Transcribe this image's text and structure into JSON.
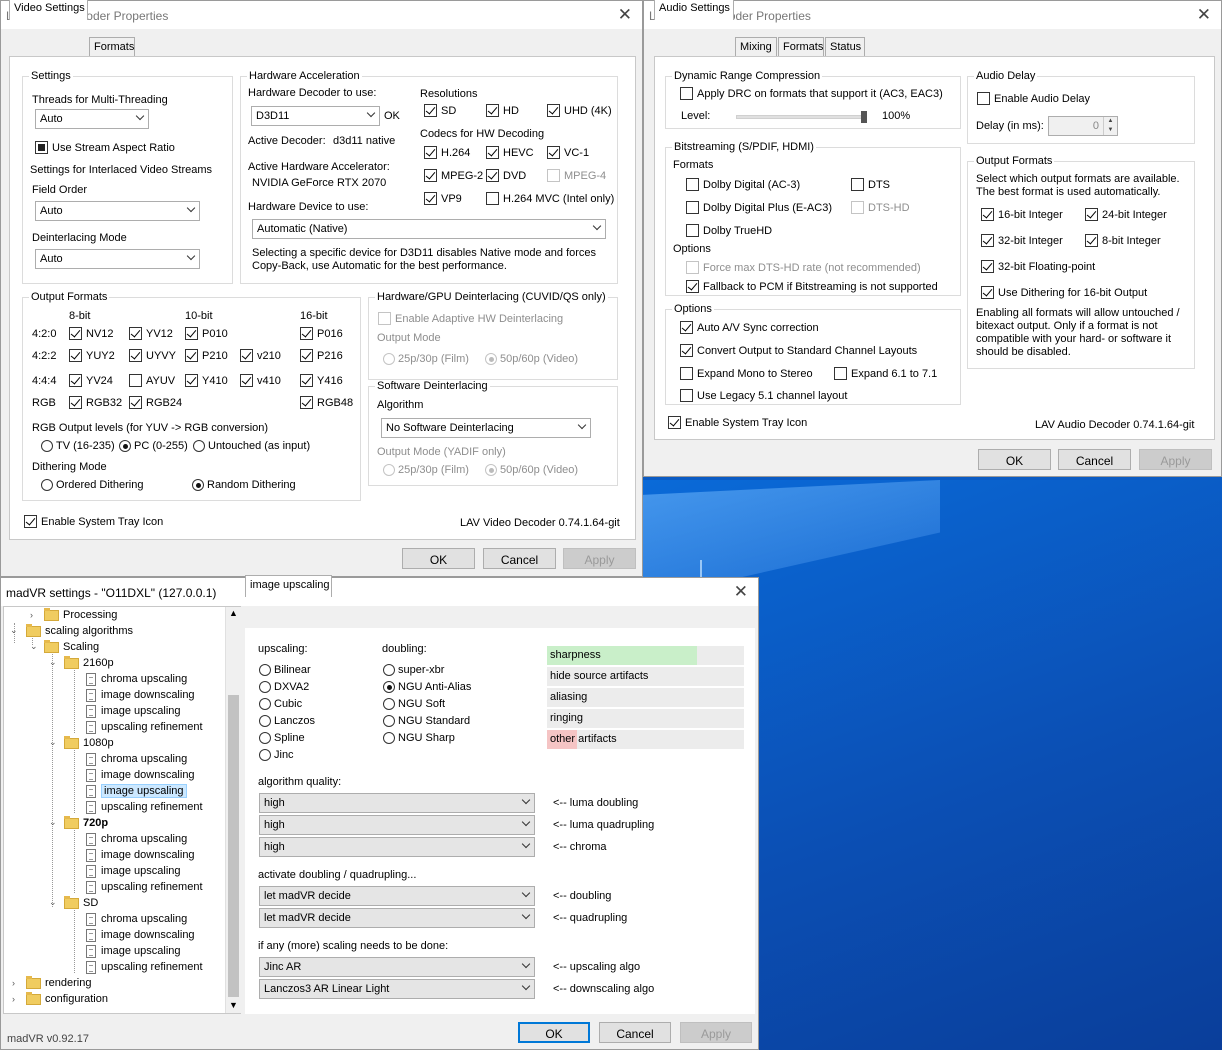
{
  "video": {
    "title": "LAV Video Decoder Properties",
    "tabs": [
      "Video Settings",
      "Formats"
    ],
    "settings": {
      "label": "Settings",
      "threads_label": "Threads for Multi-Threading",
      "threads_value": "Auto",
      "aspect_label": "Use Stream Aspect Ratio",
      "interlaced_label": "Settings for Interlaced Video Streams",
      "field_order_label": "Field Order",
      "field_order_value": "Auto",
      "deint_mode_label": "Deinterlacing Mode",
      "deint_mode_value": "Auto"
    },
    "hwaccel": {
      "label": "Hardware Acceleration",
      "decoder_label": "Hardware Decoder to use:",
      "decoder_value": "D3D11",
      "ok": "OK",
      "active_decoder_label": "Active Decoder:",
      "active_decoder_value": "d3d11 native",
      "accelerator_label": "Active Hardware Accelerator:",
      "accelerator_value": "NVIDIA GeForce RTX 2070",
      "device_label": "Hardware Device to use:",
      "device_value": "Automatic (Native)",
      "note": "Selecting a specific device for D3D11 disables Native mode and forces Copy-Back, use Automatic for the best performance.",
      "resolutions_label": "Resolutions",
      "res": [
        "SD",
        "HD",
        "UHD (4K)"
      ],
      "codecs_label": "Codecs for HW Decoding",
      "codecs": [
        "H.264",
        "HEVC",
        "VC-1",
        "MPEG-2",
        "DVD",
        "MPEG-4",
        "VP9",
        "H.264 MVC (Intel only)"
      ]
    },
    "output": {
      "label": "Output Formats",
      "cols": [
        "8-bit",
        "10-bit",
        "16-bit"
      ],
      "rows": [
        "4:2:0",
        "4:2:2",
        "4:4:4",
        "RGB"
      ],
      "fmts": [
        "NV12",
        "YV12",
        "P010",
        "P016",
        "YUY2",
        "UYVY",
        "P210",
        "v210",
        "P216",
        "YV24",
        "AYUV",
        "Y410",
        "v410",
        "Y416",
        "RGB32",
        "RGB24",
        "RGB48"
      ],
      "rgb_levels_label": "RGB Output levels (for YUV -> RGB conversion)",
      "levels": [
        "TV (16-235)",
        "PC (0-255)",
        "Untouched (as input)"
      ],
      "dither_label": "Dithering Mode",
      "dither": [
        "Ordered Dithering",
        "Random Dithering"
      ]
    },
    "hwdeint": {
      "label": "Hardware/GPU Deinterlacing (CUVID/QS only)",
      "adaptive": "Enable Adaptive HW Deinterlacing",
      "output_mode": "Output Mode",
      "film": "25p/30p (Film)",
      "video": "50p/60p (Video)"
    },
    "swdeint": {
      "label": "Software Deinterlacing",
      "algorithm_label": "Algorithm",
      "algorithm_value": "No Software Deinterlacing",
      "output_mode": "Output Mode (YADIF only)",
      "film": "25p/30p (Film)",
      "video": "50p/60p (Video)"
    },
    "tray": "Enable System Tray Icon",
    "version": "LAV Video Decoder 0.74.1.64-git",
    "buttons": [
      "OK",
      "Cancel",
      "Apply"
    ]
  },
  "audio": {
    "title": "LAV Audio Decoder Properties",
    "tabs": [
      "Audio Settings",
      "Mixing",
      "Formats",
      "Status"
    ],
    "drc": {
      "label": "Dynamic Range Compression",
      "apply": "Apply DRC on formats that support it (AC3, EAC3)",
      "level_label": "Level:",
      "level_value": "100%",
      "level_fraction": 1.0
    },
    "bitstream": {
      "label": "Bitstreaming (S/PDIF, HDMI)",
      "formats_label": "Formats",
      "formats": [
        "Dolby Digital (AC-3)",
        "DTS",
        "Dolby Digital Plus (E-AC3)",
        "DTS-HD",
        "Dolby TrueHD"
      ],
      "options_label": "Options",
      "force_dts": "Force max DTS-HD rate (not recommended)",
      "fallback": "Fallback to PCM if Bitstreaming is not supported"
    },
    "options": {
      "label": "Options",
      "av_sync": "Auto A/V Sync correction",
      "convert": "Convert Output to Standard Channel Layouts",
      "expand_mono": "Expand Mono to Stereo",
      "expand_61": "Expand 6.1 to 7.1",
      "legacy51": "Use Legacy 5.1 channel layout"
    },
    "delay": {
      "label": "Audio Delay",
      "enable": "Enable Audio Delay",
      "delay_label": "Delay (in ms):",
      "delay_value": "0"
    },
    "outfmt": {
      "label": "Output Formats",
      "desc": "Select which output formats are available. The best format is used automatically.",
      "fmts": [
        "16-bit Integer",
        "24-bit Integer",
        "32-bit Integer",
        "8-bit Integer",
        "32-bit Floating-point"
      ],
      "dither": "Use Dithering for 16-bit Output",
      "note": "Enabling all formats will allow untouched / bitexact output. Only if a format is not compatible with your hard- or software it should be disabled."
    },
    "tray": "Enable System Tray Icon",
    "version": "LAV Audio Decoder 0.74.1.64-git",
    "buttons": [
      "OK",
      "Cancel",
      "Apply"
    ]
  },
  "madvr": {
    "title": "madVR settings - \"O11DXL\" (127.0.0.1)",
    "tree": {
      "processing": "Processing",
      "scaling_algorithms": "scaling algorithms",
      "scaling": "Scaling",
      "groups": [
        "2160p",
        "1080p",
        "720p",
        "SD"
      ],
      "children": [
        "chroma upscaling",
        "image downscaling",
        "image upscaling",
        "upscaling refinement"
      ],
      "rendering": "rendering",
      "configuration": "configuration"
    },
    "tab": "image upscaling",
    "upscaling_label": "upscaling:",
    "upscaling": [
      "Bilinear",
      "DXVA2",
      "Cubic",
      "Lanczos",
      "Spline",
      "Jinc"
    ],
    "doubling_label": "doubling:",
    "doubling": [
      "super-xbr",
      "NGU Anti-Alias",
      "NGU Soft",
      "NGU Standard",
      "NGU Sharp"
    ],
    "quality_bars": [
      {
        "label": "sharpness",
        "fill": 0.76,
        "color": "#c9efc9"
      },
      {
        "label": "hide source artifacts",
        "fill": 0.0,
        "color": "#c9efc9"
      },
      {
        "label": "aliasing",
        "fill": 0.0,
        "color": "#c9efc9"
      },
      {
        "label": "ringing",
        "fill": 0.0,
        "color": "#c9efc9"
      },
      {
        "label": "other artifacts",
        "fill": 0.15,
        "color": "#f5c4c4"
      }
    ],
    "quality_label": "algorithm quality:",
    "quality": [
      {
        "value": "high",
        "desc": "<-- luma doubling"
      },
      {
        "value": "high",
        "desc": "<-- luma quadrupling"
      },
      {
        "value": "high",
        "desc": "<-- chroma"
      }
    ],
    "activate_label": "activate doubling / quadrupling...",
    "activate": [
      {
        "value": "let madVR decide",
        "desc": "<-- doubling"
      },
      {
        "value": "let madVR decide",
        "desc": "<-- quadrupling"
      }
    ],
    "ifany_label": "if any (more) scaling needs to be done:",
    "ifany": [
      {
        "value": "Jinc AR",
        "desc": "<-- upscaling algo"
      },
      {
        "value": "Lanczos3 AR Linear Light",
        "desc": "<-- downscaling algo"
      }
    ],
    "version": "madVR v0.92.17",
    "buttons": [
      "OK",
      "Cancel",
      "Apply"
    ]
  }
}
